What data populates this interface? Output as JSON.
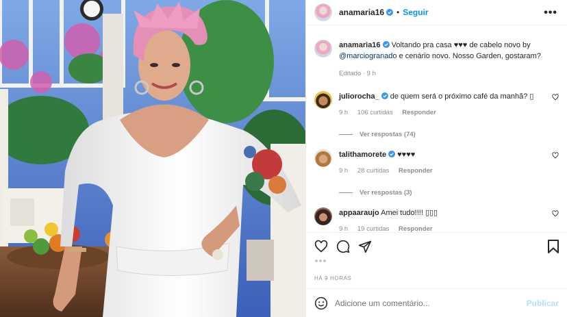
{
  "header": {
    "username": "anamaria16",
    "separator": "•",
    "follow_label": "Seguir",
    "more_label": "•••"
  },
  "caption": {
    "username": "anamaria16",
    "text_before": "Voltando pra casa ♥♥♥ de cabelo novo by ",
    "mention": "@marciogranado",
    "text_after": " e cenário novo. Nosso Garden, gostaram?",
    "edited": "Editado · 9 h"
  },
  "comments": [
    {
      "username": "juliorocha_",
      "verified": true,
      "text": "de quem será o próximo café da manhã? ▯",
      "time": "9 h",
      "likes": "106 curtidas",
      "reply_label": "Responder",
      "view_replies": "Ver respostas (74)"
    },
    {
      "username": "talithamorete",
      "verified": true,
      "text": "♥♥♥♥",
      "time": "9 h",
      "likes": "28 curtidas",
      "reply_label": "Responder",
      "view_replies": "Ver respostas (3)"
    },
    {
      "username": "appaaraujo",
      "verified": false,
      "text": "Amei tudo!!!! ▯▯▯",
      "time": "9 h",
      "likes": "19 curtidas",
      "reply_label": "Responder",
      "view_replies": ""
    }
  ],
  "post_time": "HÁ 9 HORAS",
  "add_comment": {
    "placeholder": "Adicione um comentário...",
    "publish_label": "Publicar"
  },
  "colors": {
    "accent": "#0095f6",
    "verified": "#3897f0",
    "muted": "#8e8e8e",
    "publish_disabled": "#b2dffc"
  }
}
